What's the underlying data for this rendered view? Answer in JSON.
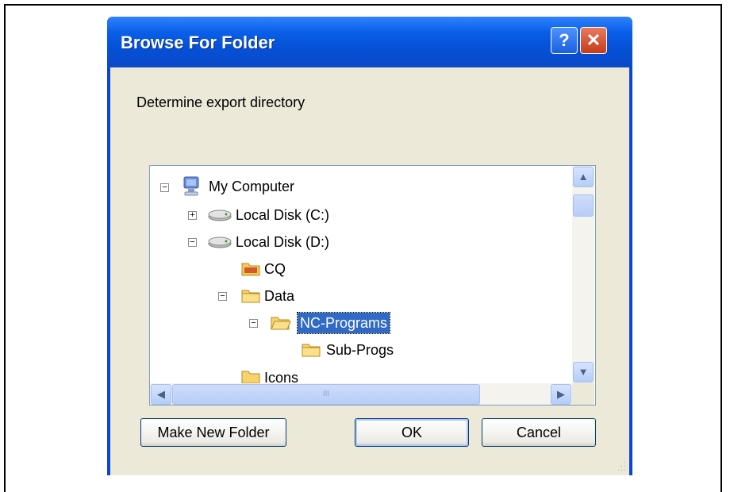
{
  "dialog": {
    "title": "Browse For Folder",
    "help_glyph": "?",
    "close_glyph": "✕",
    "description": "Determine export directory"
  },
  "tree": {
    "nodes": [
      {
        "label": "My Computer",
        "icon": "computer-icon",
        "expander": "−"
      },
      {
        "label": "Local Disk (C:)",
        "icon": "drive-icon",
        "expander": "+"
      },
      {
        "label": "Local Disk (D:)",
        "icon": "drive-icon",
        "expander": "−"
      },
      {
        "label": "CQ",
        "icon": "folder-icon",
        "expander": ""
      },
      {
        "label": "Data",
        "icon": "folder-icon",
        "expander": "−"
      },
      {
        "label": "NC-Programs",
        "icon": "folder-open-icon",
        "expander": "−",
        "selected": true
      },
      {
        "label": "Sub-Progs",
        "icon": "folder-icon",
        "expander": ""
      },
      {
        "label": "Icons",
        "icon": "folder-icon",
        "expander": ""
      }
    ]
  },
  "scrollbars": {
    "up_glyph": "▲",
    "down_glyph": "▼",
    "left_glyph": "◀",
    "right_glyph": "▶",
    "thumb_grip": "III"
  },
  "buttons": {
    "make_new_folder": "Make New Folder",
    "ok": "OK",
    "cancel": "Cancel"
  },
  "colors": {
    "titlebar": "#0a5fe8",
    "selection": "#316ac5",
    "client_bg": "#ece9d8"
  }
}
